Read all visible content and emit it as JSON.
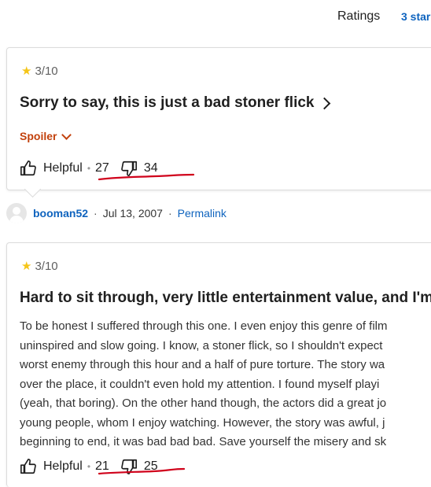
{
  "header": {
    "ratings_label": "Ratings",
    "filter_label": "3 star"
  },
  "reviews": [
    {
      "rating": "3/10",
      "title": "Sorry to say, this is just a bad stoner flick",
      "spoiler_label": "Spoiler",
      "helpful_label": "Helpful",
      "helpful_up": "27",
      "helpful_down": "34",
      "author": "booman52",
      "date": "Jul 13, 2007",
      "permalink_label": "Permalink"
    },
    {
      "rating": "3/10",
      "title": "Hard to sit through, very little entertainment value, and I'm",
      "body_lines": [
        "To be honest I suffered through this one. I even enjoy this genre of film",
        "uninspired and slow going. I know, a stoner flick, so I shouldn't expect",
        "worst enemy through this hour and a half of pure torture. The story wa",
        "over the place, it couldn't even hold my attention. I found myself playi",
        "(yeah, that boring). On the other hand though, the actors did a great jo",
        "young people, whom I enjoy watching. However, the story was awful, j",
        "beginning to end, it was bad bad bad. Save yourself the misery and sk"
      ],
      "helpful_label": "Helpful",
      "helpful_up": "21",
      "helpful_down": "25"
    }
  ],
  "colors": {
    "star": "#f5c518",
    "link": "#0e63be",
    "spoiler": "#c2410c",
    "annotation": "#d0021b"
  }
}
